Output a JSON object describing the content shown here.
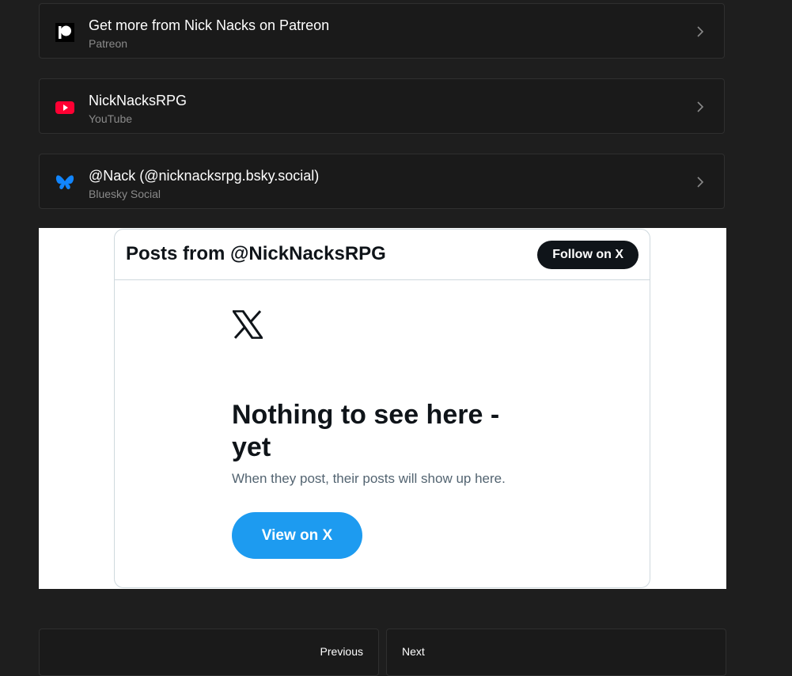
{
  "links": [
    {
      "title": "Get more from Nick Nacks on Patreon",
      "subtitle": "Patreon",
      "icon": "patreon-icon"
    },
    {
      "title": "NickNacksRPG",
      "subtitle": "YouTube",
      "icon": "youtube-icon"
    },
    {
      "title": "@Nack (@nicknacksrpg.bsky.social)",
      "subtitle": "Bluesky Social",
      "icon": "bluesky-icon"
    }
  ],
  "embed": {
    "header_title": "Posts from @NickNacksRPG",
    "follow_label": "Follow on X",
    "empty_title": "Nothing to see here - yet",
    "empty_subtitle": "When they post, their posts will show up here.",
    "view_label": "View on X"
  },
  "pager": {
    "previous_label": "Previous",
    "next_label": "Next"
  },
  "colors": {
    "page_bg": "#1e1e1e",
    "youtube_red": "#ff0033",
    "bluesky_blue": "#1185fe",
    "x_blue": "#1d9bf0"
  }
}
